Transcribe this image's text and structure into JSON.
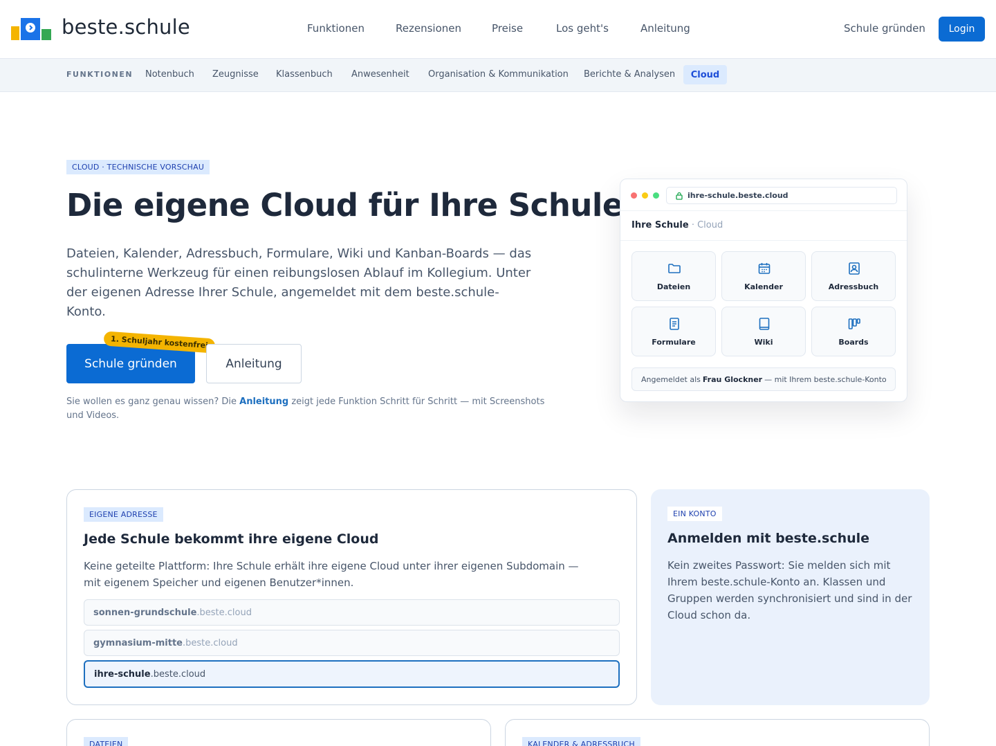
{
  "header": {
    "brand": "beste.schule",
    "nav": [
      "Funktionen",
      "Rezensionen",
      "Preise",
      "Los geht's",
      "Anleitung"
    ],
    "found_school": "Schule gründen",
    "login": "Login"
  },
  "subnav": {
    "label": "FUNKTIONEN",
    "items": [
      "Notenbuch",
      "Zeugnisse",
      "Klassenbuch",
      "Anwesenheit",
      "Organisation & Kommunikation",
      "Berichte & Analysen"
    ],
    "active": "Cloud"
  },
  "hero": {
    "tag": "CLOUD · TECHNISCHE VORSCHAU",
    "title": "Die eigene Cloud für Ihre Schule",
    "text": "Dateien, Kalender, Adressbuch, Formulare, Wiki und Kanban-Boards — das schulinterne Werkzeug für einen reibungslosen Ablauf im Kollegium. Unter der eigenen Adresse Ihrer Schule, angemeldet mit dem beste.schule-Konto.",
    "primary_button": "Schule gründen",
    "badge": "1. Schuljahr kostenfrei",
    "secondary_button": "Anleitung",
    "note_before": "Sie wollen es ganz genau wissen? Die ",
    "note_link": "Anleitung",
    "note_after": " zeigt jede Funktion Schritt für Schritt — mit Screenshots und Videos."
  },
  "mock": {
    "url": "ihre-schule.beste.cloud",
    "title": "Ihre Schule",
    "title_sub": " · Cloud",
    "tiles": [
      {
        "label": "Dateien",
        "icon": "folder-icon"
      },
      {
        "label": "Kalender",
        "icon": "calendar-icon"
      },
      {
        "label": "Adressbuch",
        "icon": "contact-book-icon"
      },
      {
        "label": "Formulare",
        "icon": "document-icon"
      },
      {
        "label": "Wiki",
        "icon": "book-icon"
      },
      {
        "label": "Boards",
        "icon": "kanban-icon"
      }
    ],
    "footer_before": "Angemeldet als",
    "footer_user": "Frau Glockner",
    "footer_after": "— mit Ihrem beste.schule-Konto"
  },
  "card_address": {
    "tag": "EIGENE ADRESSE",
    "title": "Jede Schule bekommt ihre eigene Cloud",
    "text": "Keine geteilte Plattform: Ihre Schule erhält ihre eigene Cloud unter ihrer eigenen Subdomain — mit eigenem Speicher und eigenen Benutzer*innen.",
    "domains": [
      {
        "sub": "sonnen-grundschule",
        "suffix": ".beste.cloud"
      },
      {
        "sub": "gymnasium-mitte",
        "suffix": ".beste.cloud"
      },
      {
        "sub": "ihre-schule",
        "suffix": ".beste.cloud"
      }
    ]
  },
  "card_account": {
    "tag": "EIN KONTO",
    "title": "Anmelden mit beste.schule",
    "text": "Kein zweites Passwort: Sie melden sich mit Ihrem beste.schule-Konto an. Klassen und Gruppen werden synchronisiert und sind in der Cloud schon da."
  },
  "card_files": {
    "tag": "DATEIEN"
  },
  "card_calendar": {
    "tag": "KALENDER & ADRESSBUCH"
  },
  "colors": {
    "primary": "#0b6bd3",
    "accent_yellow": "#f4b400",
    "tag_bg": "#dbeafe"
  }
}
